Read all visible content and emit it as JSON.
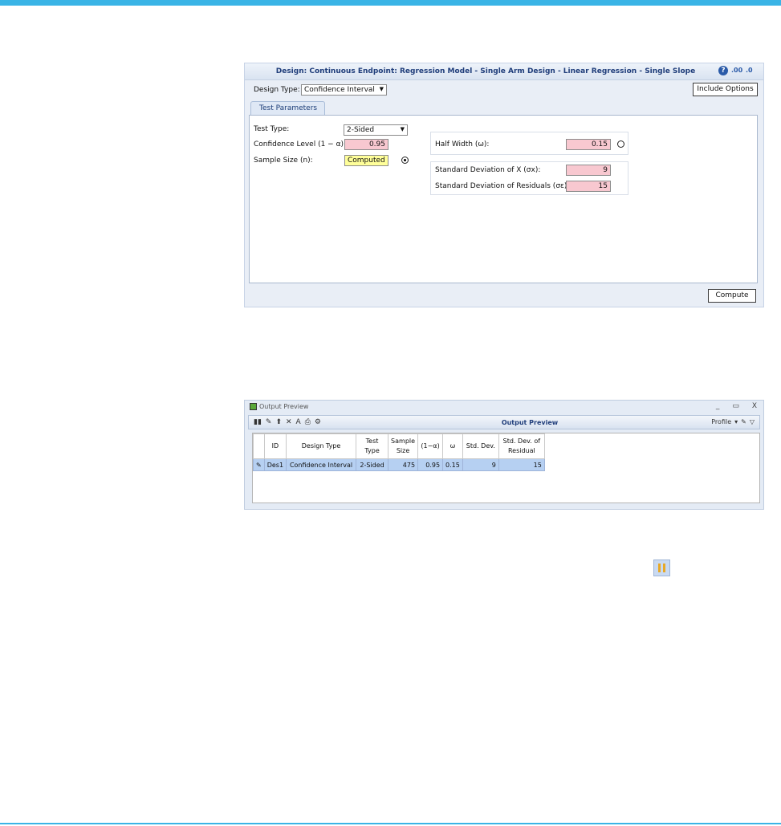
{
  "design_window": {
    "title": "Design: Continuous Endpoint: Regression Model - Single Arm Design - Linear Regression - Single Slope",
    "help_icon": "?",
    "design_type_label": "Design Type:",
    "design_type_value": "Confidence Interval",
    "include_options_label": "Include Options",
    "tab_label": "Test Parameters",
    "test_type_label": "Test Type:",
    "test_type_value": "2-Sided",
    "confidence_level_label": "Confidence Level (1 − α):",
    "confidence_level_value": "0.95",
    "sample_size_label": "Sample Size (n):",
    "sample_size_value": "Computed",
    "half_width_label": "Half Width (ω):",
    "half_width_value": "0.15",
    "sd_x_label": "Standard Deviation of X (σx):",
    "sd_x_value": "9",
    "sd_resid_label": "Standard Deviation of Residuals (σε):",
    "sd_resid_value": "15",
    "compute_label": "Compute"
  },
  "output_preview": {
    "window_title": "Output Preview",
    "toolbar_title": "Output Preview",
    "profile_label": "Profile",
    "controls": [
      "_",
      "▭",
      "X"
    ],
    "columns": [
      "ID",
      "Design Type",
      "Test Type",
      "Sample Size",
      "(1−α)",
      "ω",
      "Std. Dev.",
      "Std. Dev. of Residual"
    ],
    "rows": [
      {
        "id": "Des1",
        "design_type": "Confidence Interval",
        "test_type": "2-Sided",
        "sample_size": "475",
        "conf": "0.95",
        "omega": "0.15",
        "sd": "9",
        "sd_resid": "15"
      }
    ]
  },
  "colors": {
    "accent": "#3ab4e6",
    "required_field": "#f8c8d0",
    "computed_field": "#ffff99",
    "selected_row": "#b6d0f2"
  }
}
